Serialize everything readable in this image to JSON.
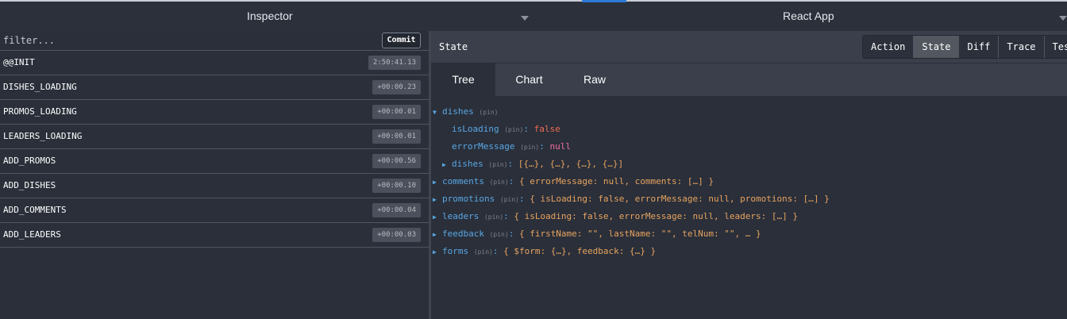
{
  "header": {
    "left_title": "Inspector",
    "right_title": "React App"
  },
  "filter": {
    "placeholder": "filter...",
    "commit_label": "Commit"
  },
  "actions": [
    {
      "name": "@@INIT",
      "time": "2:50:41.13"
    },
    {
      "name": "DISHES_LOADING",
      "time": "+00:00.23"
    },
    {
      "name": "PROMOS_LOADING",
      "time": "+00:00.01"
    },
    {
      "name": "LEADERS_LOADING",
      "time": "+00:00.01"
    },
    {
      "name": "ADD_PROMOS",
      "time": "+00:00.56"
    },
    {
      "name": "ADD_DISHES",
      "time": "+00:00.10"
    },
    {
      "name": "ADD_COMMENTS",
      "time": "+00:00.04"
    },
    {
      "name": "ADD_LEADERS",
      "time": "+00:00.03"
    }
  ],
  "monitor": {
    "section_label": "State",
    "modes": [
      "Action",
      "State",
      "Diff",
      "Trace",
      "Test"
    ],
    "active_mode": "State",
    "views": [
      "Tree",
      "Chart",
      "Raw"
    ],
    "active_view": "Tree"
  },
  "tree": {
    "pin": "(pin)",
    "dishes": {
      "key": "dishes"
    },
    "isLoading": {
      "key": "isLoading",
      "value": "false"
    },
    "errorMessage": {
      "key": "errorMessage",
      "value": "null"
    },
    "dishes_list": {
      "key": "dishes",
      "preview": "[{…}, {…}, {…}, {…}]"
    },
    "comments": {
      "key": "comments",
      "preview": "{ errorMessage: null, comments: […] }"
    },
    "promotions": {
      "key": "promotions",
      "preview": "{ isLoading: false, errorMessage: null, promotions: […] }"
    },
    "leaders": {
      "key": "leaders",
      "preview": "{ isLoading: false, errorMessage: null, leaders: […] }"
    },
    "feedback": {
      "key": "feedback",
      "preview": "{ firstName: \"\", lastName: \"\", telNum: \"\", … }"
    },
    "forms": {
      "key": "forms",
      "preview": "{ $form: {…}, feedback: {…} }"
    }
  },
  "icons": {
    "expanded": "caret-down-icon",
    "collapsed": "caret-right-icon",
    "dropdown": "chevron-down-icon"
  },
  "colors": {
    "background": "#2a2f3a",
    "key": "#5aa7e3",
    "string_preview": "#e8a35f",
    "boolean": "#f06b52",
    "null": "#f3709e",
    "accent": "#2d7ad6"
  }
}
